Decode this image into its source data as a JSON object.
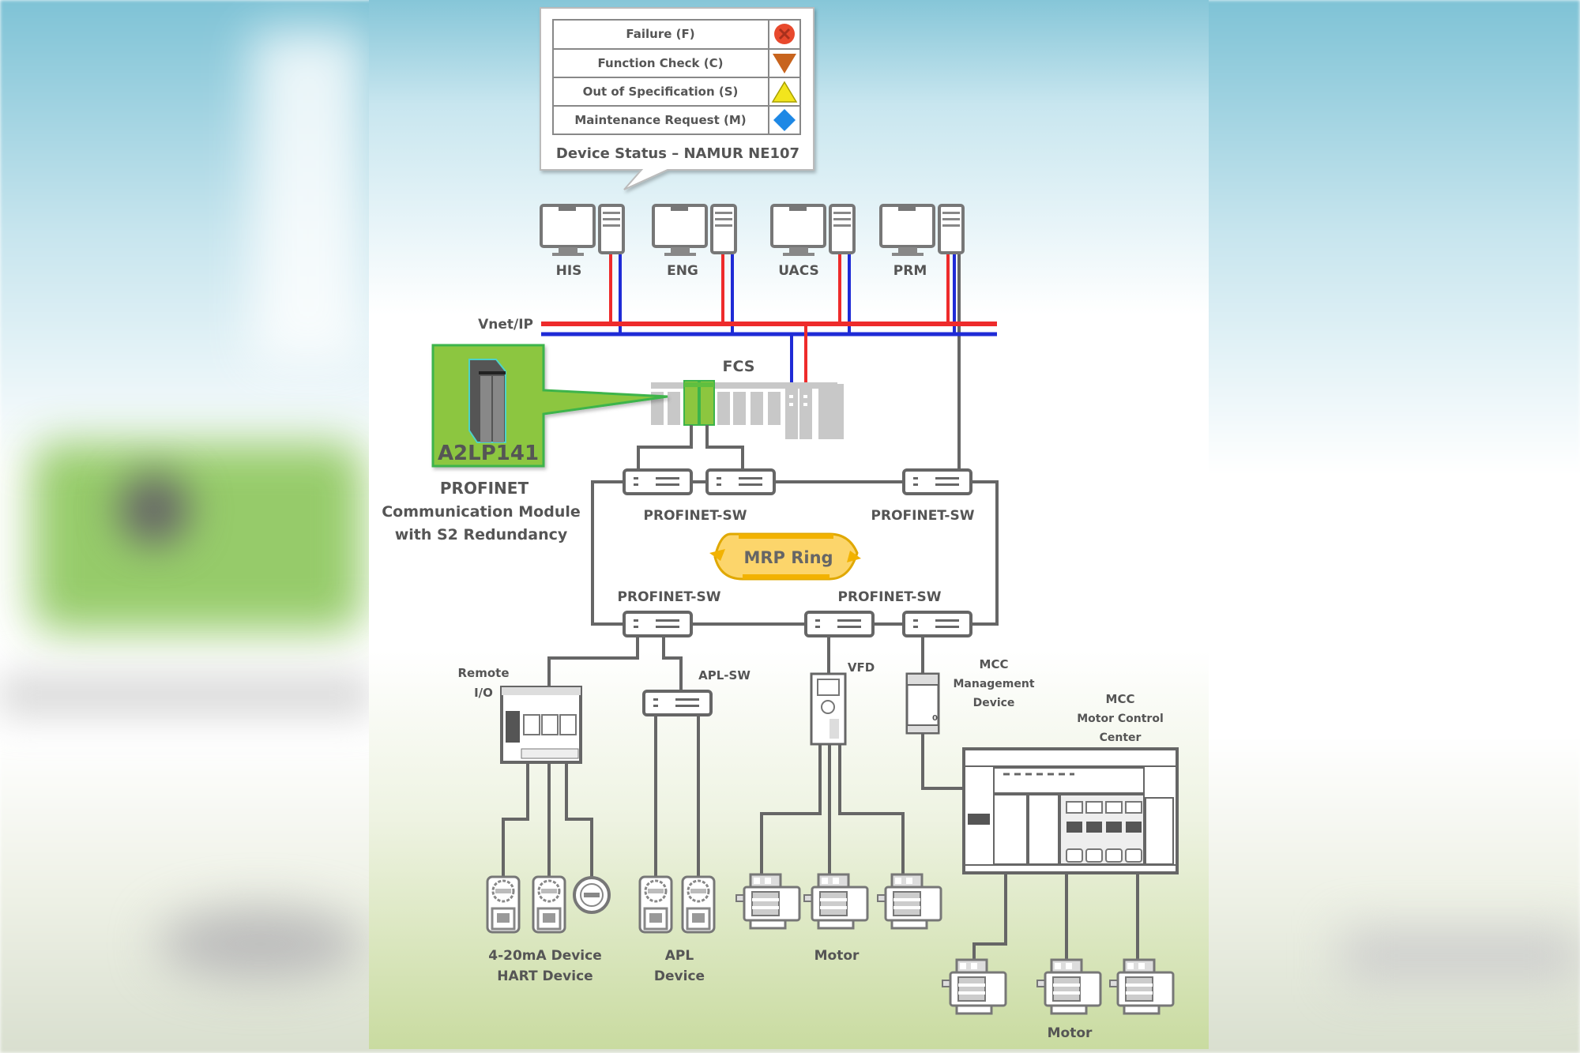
{
  "legend": {
    "caption": "Device Status – NAMUR NE107",
    "rows": [
      {
        "label": "Failure (F)",
        "icon": "failure-icon",
        "color": "#e8492d"
      },
      {
        "label": "Function Check (C)",
        "icon": "function-check-icon",
        "color": "#c8641e"
      },
      {
        "label": "Out of Specification (S)",
        "icon": "out-of-spec-icon",
        "color": "#f2e51d"
      },
      {
        "label": "Maintenance Request (M)",
        "icon": "maintenance-request-icon",
        "color": "#1e88e5"
      }
    ]
  },
  "stations": [
    {
      "label": "HIS"
    },
    {
      "label": "ENG"
    },
    {
      "label": "UACS"
    },
    {
      "label": "PRM"
    }
  ],
  "network": {
    "bus_label": "Vnet/IP",
    "bus_colors": {
      "primary": "#ee2b2b",
      "secondary": "#1f2bd6"
    },
    "fcs_label": "FCS"
  },
  "module": {
    "model": "A2LP141",
    "title": "PROFINET",
    "line2": "Communication Module",
    "line3": "with S2 Redundancy",
    "accent": "#8cc63f"
  },
  "switches": {
    "top_left_label": "PROFINET-SW",
    "top_right_label": "PROFINET-SW",
    "bottom_left_label": "PROFINET-SW",
    "bottom_right_label": "PROFINET-SW",
    "ring_label": "MRP Ring",
    "ring_color": "#f7c531"
  },
  "field": {
    "remote_io": [
      "Remote",
      "I/O"
    ],
    "apl_sw": "APL-SW",
    "vfd": "VFD",
    "mcc_mgmt": [
      "MCC",
      "Management",
      "Device"
    ],
    "mcc": [
      "MCC",
      "Motor Control",
      "Center"
    ],
    "devices_4_20": [
      "4-20mA Device",
      "HART Device"
    ],
    "apl_device": [
      "APL",
      "Device"
    ],
    "motor_label_1": "Motor",
    "motor_label_2": "Motor"
  }
}
